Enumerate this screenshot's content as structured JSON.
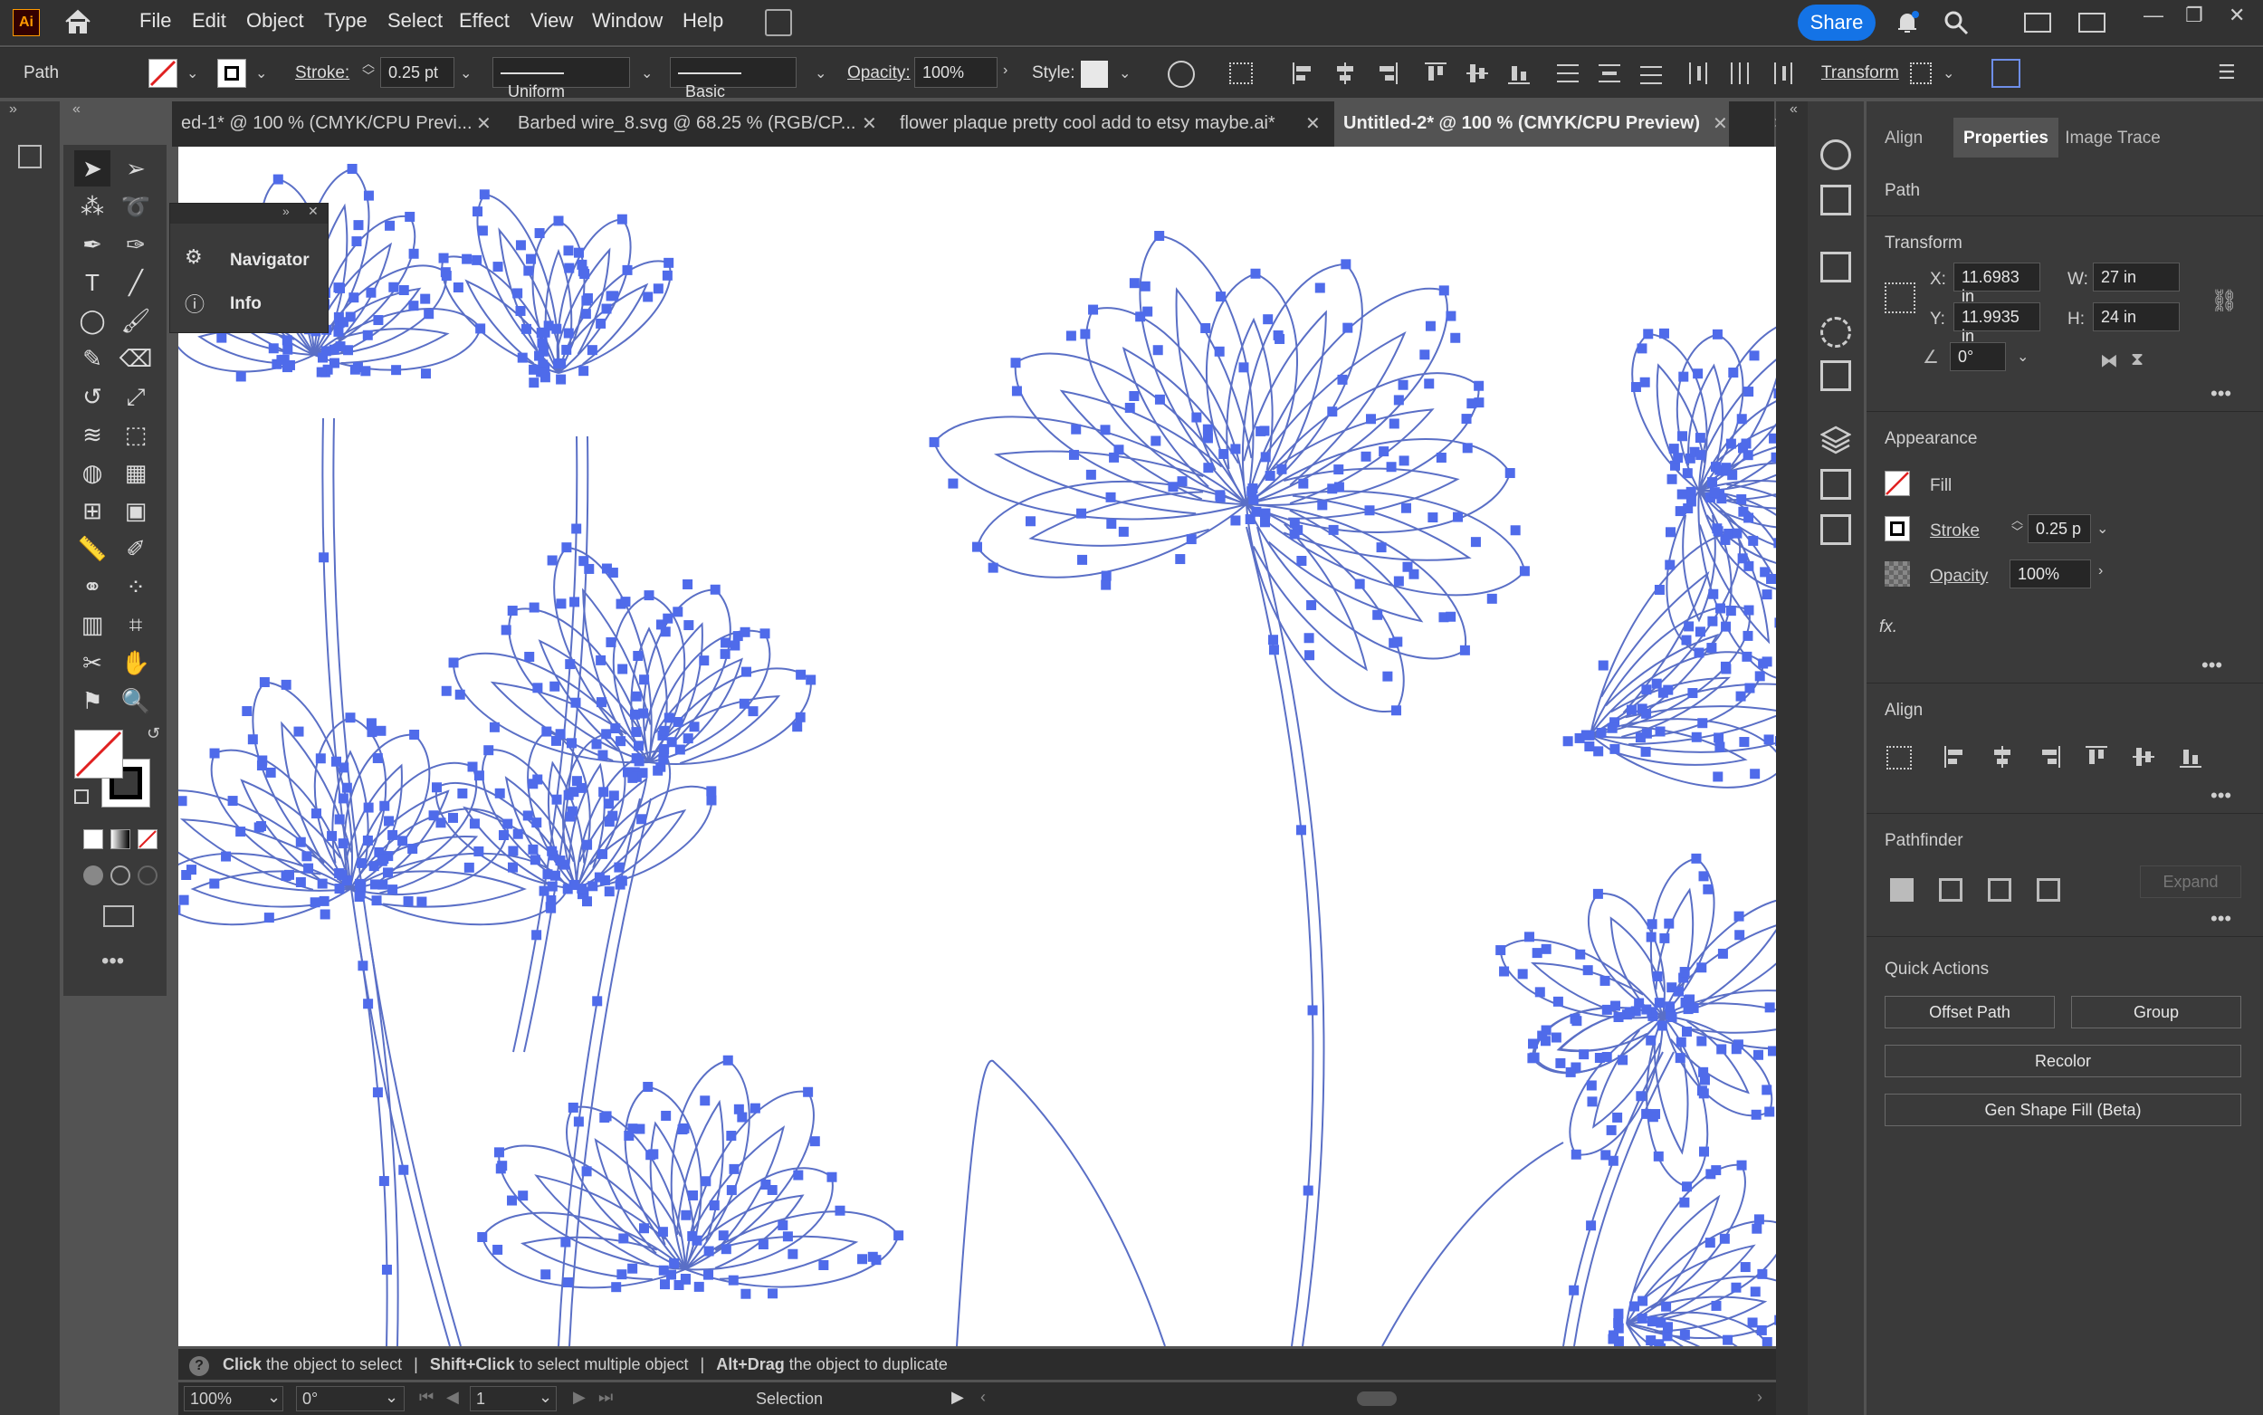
{
  "app": {
    "logo": "Ai"
  },
  "menu": [
    "File",
    "Edit",
    "Object",
    "Type",
    "Select",
    "Effect",
    "View",
    "Window",
    "Help"
  ],
  "share_label": "Share",
  "control": {
    "selection_type": "Path",
    "stroke_label": "Stroke:",
    "stroke_value": "0.25 pt",
    "profile": "Uniform",
    "brush": "Basic",
    "opacity_label": "Opacity:",
    "opacity_value": "100%",
    "style_label": "Style:",
    "transform_label": "Transform"
  },
  "tabs": [
    {
      "label": "ed-1* @ 100 % (CMYK/CPU Previ...",
      "active": false
    },
    {
      "label": "Barbed wire_8.svg @ 68.25 % (RGB/CP...",
      "active": false
    },
    {
      "label": "flower plaque pretty cool add to etsy maybe.ai*",
      "active": false
    },
    {
      "label": "Untitled-2* @ 100 % (CMYK/CPU Preview)",
      "active": true
    }
  ],
  "floating_panel": {
    "items": [
      "Navigator",
      "Info"
    ]
  },
  "properties": {
    "tabs": [
      "Align",
      "Properties",
      "Image Trace"
    ],
    "object_type": "Path",
    "transform": {
      "title": "Transform",
      "x_label": "X:",
      "x": "11.6983 in",
      "y_label": "Y:",
      "y": "11.9935 in",
      "w_label": "W:",
      "w": "27 in",
      "h_label": "H:",
      "h": "24 in",
      "angle": "0°"
    },
    "appearance": {
      "title": "Appearance",
      "fill_label": "Fill",
      "stroke_label": "Stroke",
      "stroke_value": "0.25 p",
      "opacity_label": "Opacity",
      "opacity_value": "100%",
      "fx": "fx."
    },
    "align_title": "Align",
    "pathfinder": {
      "title": "Pathfinder",
      "expand_label": "Expand"
    },
    "quick_actions": {
      "title": "Quick Actions",
      "offset_path": "Offset Path",
      "group": "Group",
      "recolor": "Recolor",
      "gen_shape_fill": "Gen Shape Fill (Beta)"
    }
  },
  "status": {
    "hint_1_bold": "Click",
    "hint_1": " the object to select",
    "hint_2_bold": "Shift+Click",
    "hint_2": " to select multiple object",
    "hint_3_bold": "Alt+Drag",
    "hint_3": " the object to duplicate",
    "zoom": "100%",
    "rotation": "0°",
    "artboard": "1",
    "tool": "Selection"
  },
  "colors": {
    "accent": "#1473e6",
    "anchor": "#4f6bea",
    "path": "#5a6fc6"
  }
}
